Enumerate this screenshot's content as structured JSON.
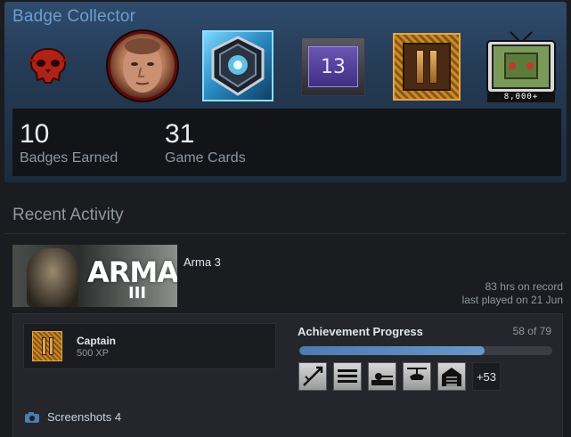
{
  "showcase": {
    "title": "Badge Collector",
    "badges": [
      {
        "name": "skull-badge"
      },
      {
        "name": "avatar-badge"
      },
      {
        "name": "hex-badge"
      },
      {
        "name": "level-badge",
        "label": "13"
      },
      {
        "name": "gold-badge"
      },
      {
        "name": "tv-badge",
        "label": "8,000+"
      }
    ],
    "stats": {
      "badges_value": "10",
      "badges_label": "Badges Earned",
      "cards_value": "31",
      "cards_label": "Game Cards"
    }
  },
  "recent_activity": {
    "title": "Recent Activity",
    "game": {
      "name": "Arma 3",
      "capsule_logo": "ARMA",
      "capsule_sub": "III",
      "hours": "83 hrs on record",
      "last_played": "last played on 21 Jun"
    },
    "xp": {
      "level": "Captain",
      "points": "500 XP"
    },
    "achievements": {
      "title": "Achievement Progress",
      "count": "58 of 79",
      "progress": 0.734,
      "more": "+53",
      "icons": [
        "achievement-1-icon",
        "achievement-2-icon",
        "achievement-3-icon",
        "achievement-4-icon",
        "achievement-5-icon"
      ]
    },
    "screenshots_label": "Screenshots 4"
  },
  "colors": {
    "accent": "#6b9fd3",
    "progress": "#4b7bb0",
    "background": "#1b1c1f"
  }
}
